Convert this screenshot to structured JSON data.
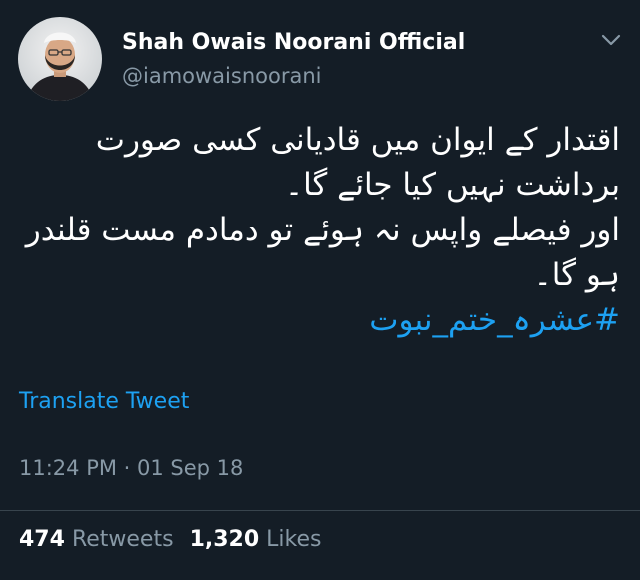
{
  "tweet": {
    "display_name": "Shah Owais Noorani Official",
    "handle": "@iamowaisnoorani",
    "avatar_icon": "profile-photo",
    "menu_icon": "chevron-down-icon",
    "body_lines": [
      "اقتدار کے ایوان میں قادیانی کسی صورت برداشت نہیں کیا جائے گا۔",
      "اور فیصلے واپس نہ ہوئے تو دمادم مست قلندر ہو گا۔"
    ],
    "hashtag": "#عشرہ_ختم_نبوت",
    "translate_label": "Translate Tweet",
    "timestamp": "11:24 PM · 01 Sep 18",
    "retweets_count": "474",
    "retweets_label": "Retweets",
    "likes_count": "1,320",
    "likes_label": "Likes"
  },
  "colors": {
    "background": "#141d26",
    "text_primary": "#ffffff",
    "text_secondary": "#8899a6",
    "link": "#1da1f2",
    "divider": "#38444d"
  }
}
